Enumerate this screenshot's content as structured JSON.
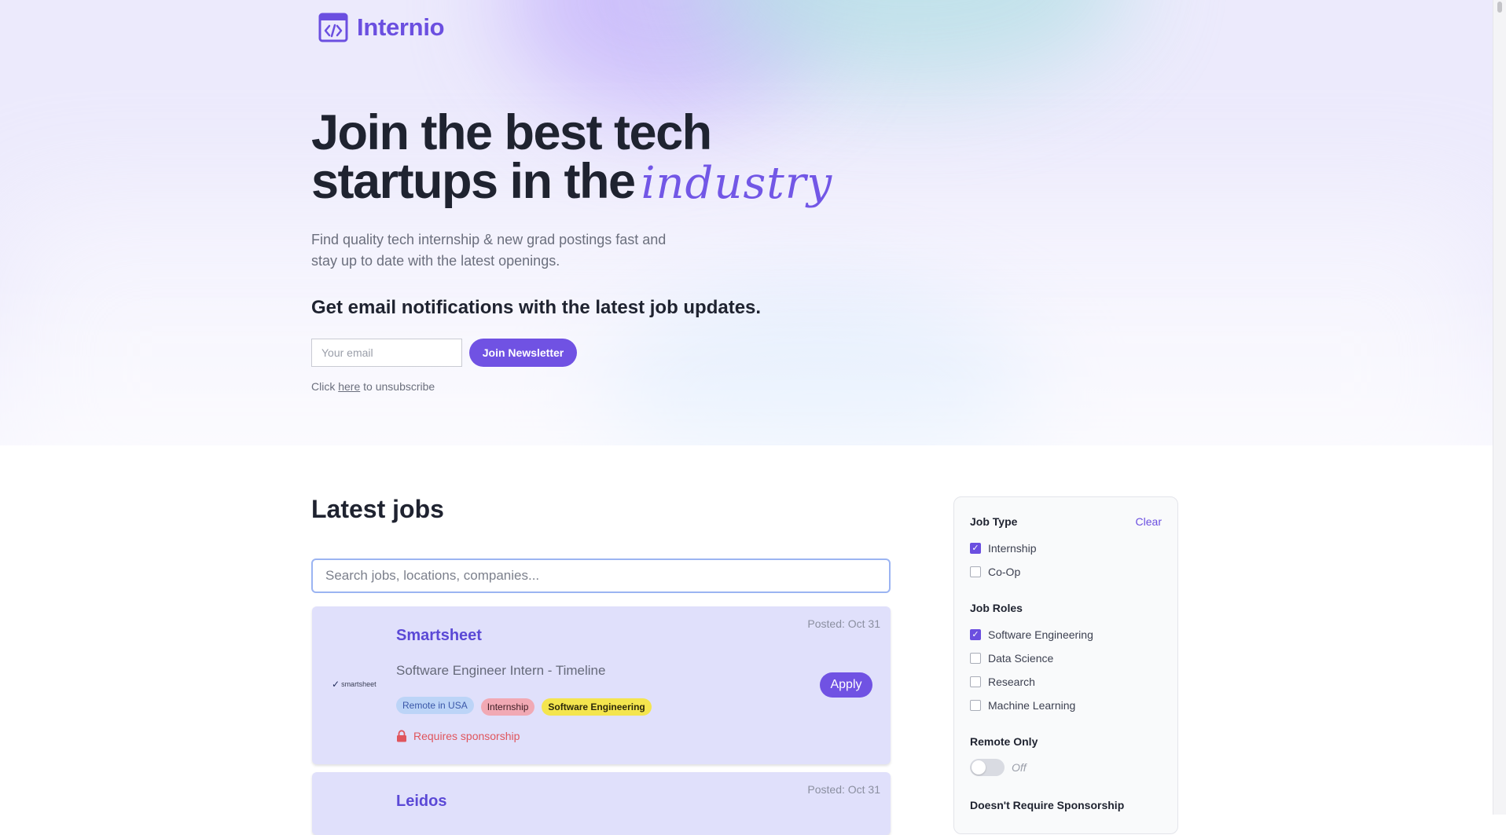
{
  "brand": {
    "name": "Internio",
    "logo_icon": "code-window-icon"
  },
  "hero": {
    "title_line1": "Join the best tech",
    "title_line2": "startups in the",
    "title_script": "industry",
    "subtitle": "Find quality tech internship & new grad postings fast and stay up to date with the latest openings.",
    "email_heading": "Get email notifications with the latest job updates.",
    "email_placeholder": "Your email",
    "join_button": "Join Newsletter",
    "unsubscribe_prefix": "Click",
    "unsubscribe_link": "here",
    "unsubscribe_suffix": "to unsubscribe"
  },
  "jobs_section": {
    "title": "Latest jobs",
    "search_placeholder": "Search jobs, locations, companies..."
  },
  "jobs": [
    {
      "posted": "Posted: Oct 31",
      "company": "Smartsheet",
      "logo_text": "smartsheet",
      "role": "Software Engineer Intern - Timeline",
      "tags": [
        "Remote in USA",
        "Internship",
        "Software Engineering"
      ],
      "sponsorship": "Requires sponsorship",
      "apply": "Apply"
    },
    {
      "posted": "Posted: Oct 31",
      "company": "Leidos"
    }
  ],
  "filters": {
    "clear": "Clear",
    "job_type": {
      "title": "Job Type",
      "options": [
        {
          "label": "Internship",
          "checked": true
        },
        {
          "label": "Co-Op",
          "checked": false
        }
      ]
    },
    "job_roles": {
      "title": "Job Roles",
      "options": [
        {
          "label": "Software Engineering",
          "checked": true
        },
        {
          "label": "Data Science",
          "checked": false
        },
        {
          "label": "Research",
          "checked": false
        },
        {
          "label": "Machine Learning",
          "checked": false
        }
      ]
    },
    "remote_only": {
      "title": "Remote Only",
      "state": "Off"
    },
    "sponsorship": {
      "title": "Doesn't Require Sponsorship"
    }
  },
  "colors": {
    "accent": "#7052e3",
    "brand": "#6b4fe0",
    "card_bg": "#e0e0fb",
    "sponsor_red": "#e0555d"
  }
}
